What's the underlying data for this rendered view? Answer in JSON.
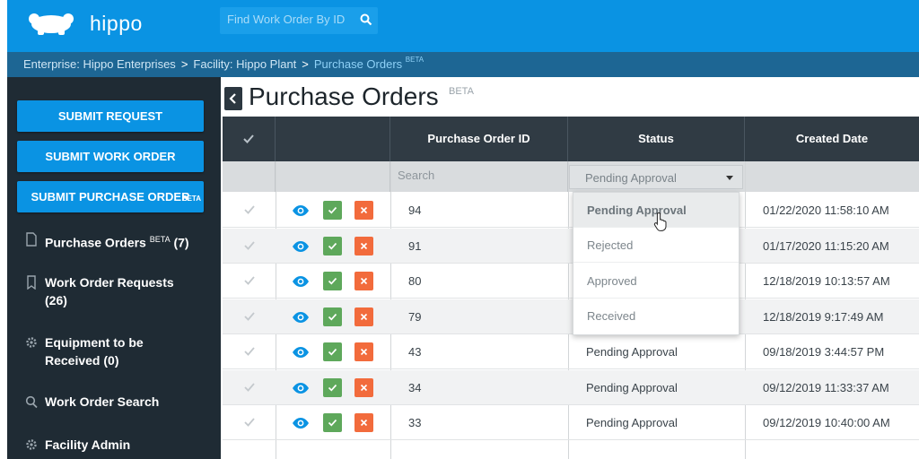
{
  "app": {
    "brand": "hippo",
    "search_placeholder": "Find Work Order By ID"
  },
  "breadcrumb": {
    "items": [
      "Enterprise: Hippo Enterprises",
      "Facility: Hippo Plant",
      "Purchase Orders"
    ],
    "separator": ">",
    "current_badge": "BETA"
  },
  "sidebar": {
    "buttons": [
      {
        "label": "SUBMIT REQUEST"
      },
      {
        "label": "SUBMIT WORK ORDER"
      },
      {
        "label": "SUBMIT PURCHASE ORDER",
        "badge": "BETA"
      }
    ],
    "nav": [
      {
        "label": "Purchase Orders",
        "badge": "BETA",
        "count": "(7)",
        "icon": "document-icon"
      },
      {
        "label": "Work Order Requests",
        "count": "(26)",
        "icon": "bookmark-icon"
      },
      {
        "label": "Equipment to be",
        "label2": "Received (0)",
        "icon": "gear-icon"
      },
      {
        "label": "Work Order Search",
        "icon": "search-icon"
      },
      {
        "label": "Facility Admin",
        "icon": "gear-icon"
      }
    ]
  },
  "page": {
    "title": "Purchase Orders",
    "title_badge": "BETA"
  },
  "table": {
    "headers": [
      "Purchase Order ID",
      "Status",
      "Created Date"
    ],
    "filter_placeholder": "Search",
    "status_filter_value": "Pending Approval",
    "rows": [
      {
        "id": "94",
        "status": "",
        "date": "01/22/2020 11:58:10 AM"
      },
      {
        "id": "91",
        "status": "",
        "date": "01/17/2020 11:15:20 AM"
      },
      {
        "id": "80",
        "status": "",
        "date": "12/18/2019 10:13:57 AM"
      },
      {
        "id": "79",
        "status": "",
        "date": "12/18/2019 9:17:49 AM"
      },
      {
        "id": "43",
        "status": "Pending Approval",
        "date": "09/18/2019 3:44:57 PM"
      },
      {
        "id": "34",
        "status": "Pending Approval",
        "date": "09/12/2019 11:33:37 AM"
      },
      {
        "id": "33",
        "status": "Pending Approval",
        "date": "09/12/2019 10:40:00 AM"
      }
    ],
    "status_options": [
      "Pending Approval",
      "Rejected",
      "Approved",
      "Received"
    ]
  },
  "colors": {
    "topbar": "#0a93e3",
    "breadcrumb_bar": "#1d6694",
    "sidebar": "#1f2b34",
    "header": "#303b44",
    "approve": "#5ea85b",
    "reject": "#f26b3c",
    "eye": "#0a93e3"
  }
}
